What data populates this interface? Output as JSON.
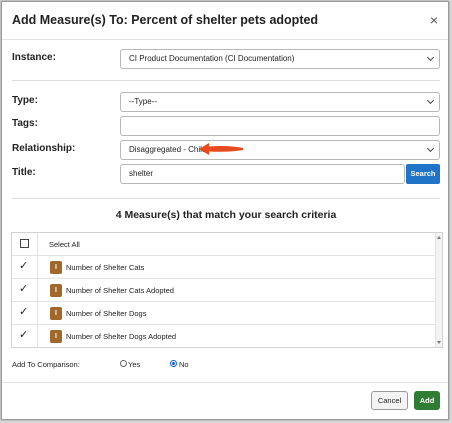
{
  "dialog": {
    "title": "Add Measure(s) To: Percent of shelter pets adopted",
    "close_icon": "close-icon"
  },
  "form": {
    "instance": {
      "label": "Instance:",
      "value": "CI Product Documentation (CI Documentation)"
    },
    "type": {
      "label": "Type:",
      "value": "--Type--"
    },
    "tags": {
      "label": "Tags:",
      "value": ""
    },
    "relationship": {
      "label": "Relationship:",
      "value": "Disaggregated - Child"
    },
    "title": {
      "label": "Title:",
      "value": "shelter",
      "search_label": "Search"
    }
  },
  "results": {
    "heading": "4 Measure(s) that match your search criteria",
    "select_all_label": "Select All",
    "badge_text": "I",
    "rows": [
      {
        "label": "Number of Shelter Cats",
        "checked": true
      },
      {
        "label": "Number of Shelter Cats Adopted",
        "checked": true
      },
      {
        "label": "Number of Shelter Dogs",
        "checked": true
      },
      {
        "label": "Number of Shelter Dogs Adopted",
        "checked": true
      }
    ]
  },
  "comparison": {
    "label": "Add To Comparison:",
    "yes_label": "Yes",
    "no_label": "No",
    "selected": "No"
  },
  "footer": {
    "cancel_label": "Cancel",
    "add_label": "Add"
  },
  "colors": {
    "accent_blue": "#1f74c8",
    "add_green": "#2e7d32",
    "badge_brown": "#a0682a",
    "arrow_red": "#e8491d"
  },
  "icons": [
    "close-icon",
    "chevron-down-icon",
    "checkmark-icon",
    "measure-badge-icon",
    "red-arrow-icon"
  ]
}
